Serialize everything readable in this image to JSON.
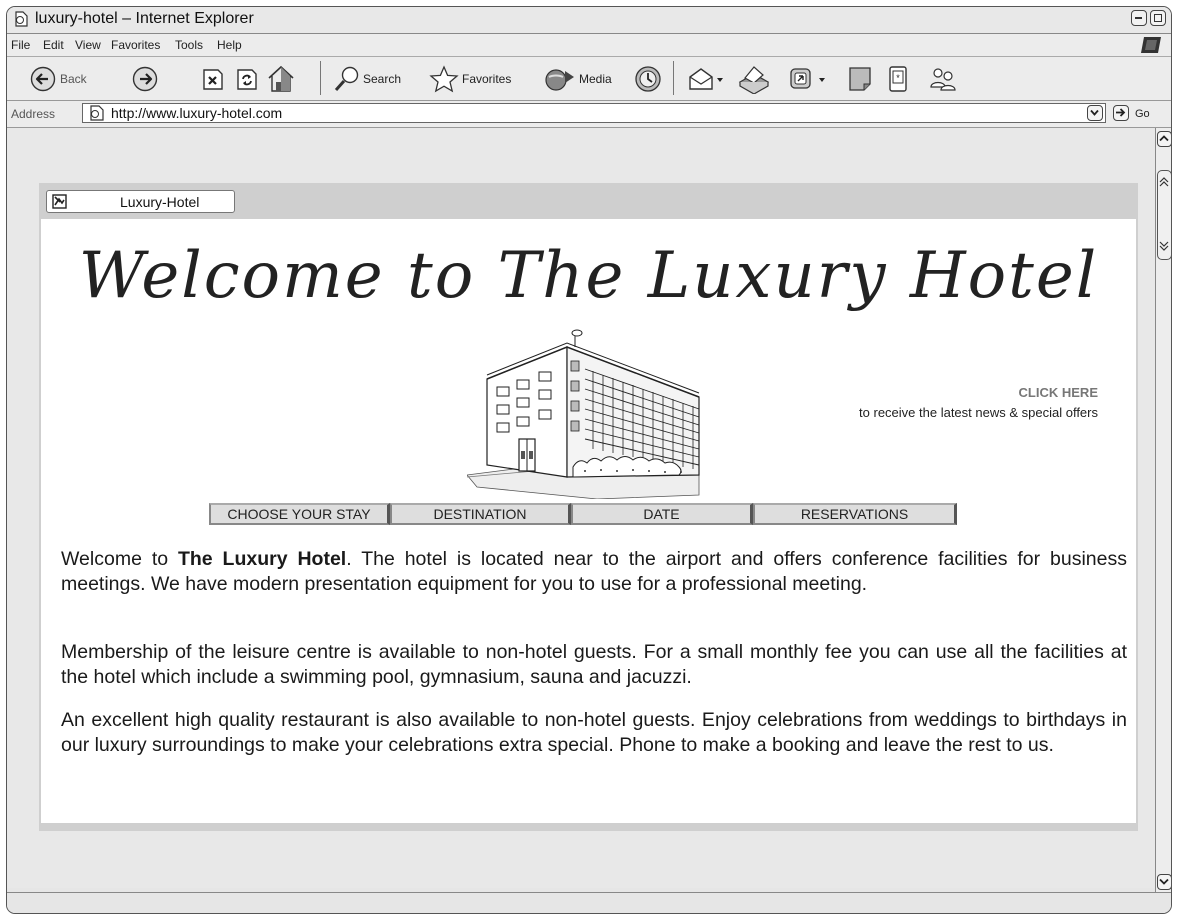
{
  "window": {
    "title": "luxury-hotel – Internet Explorer"
  },
  "menu": [
    "File",
    "Edit",
    "View",
    "Favorites",
    "Tools",
    "Help"
  ],
  "toolbar": {
    "back_label": "Back",
    "search_label": "Search",
    "favorites_label": "Favorites",
    "media_label": "Media"
  },
  "address": {
    "label": "Address",
    "url": "http://www.luxury-hotel.com",
    "go_label": "Go"
  },
  "page": {
    "tab_label": "Luxury-Hotel",
    "headline": "Welcome to The Luxury Hotel",
    "click_here": "CLICK HERE",
    "click_sub": "to receive the latest news & special offers",
    "nav": [
      "CHOOSE YOUR STAY",
      "DESTINATION",
      "DATE",
      "RESERVATIONS"
    ],
    "para1_pre": "Welcome to ",
    "para1_bold": "The Luxury Hotel",
    "para1_post": ". The hotel is located near to the airport and offers conference facilities for business meetings. We have modern presentation equipment for you to use for a professional meeting.",
    "para2": "Membership of the leisure centre is available to non-hotel guests. For a small monthly fee you can use all the facilities at the hotel which include a swimming pool, gymnasium, sauna and jacuzzi.",
    "para3": "An excellent high quality restaurant is also available to non-hotel guests. Enjoy celebrations from weddings to birthdays in our luxury surroundings to make your celebrations extra special. Phone to make a booking and leave the rest to us."
  }
}
